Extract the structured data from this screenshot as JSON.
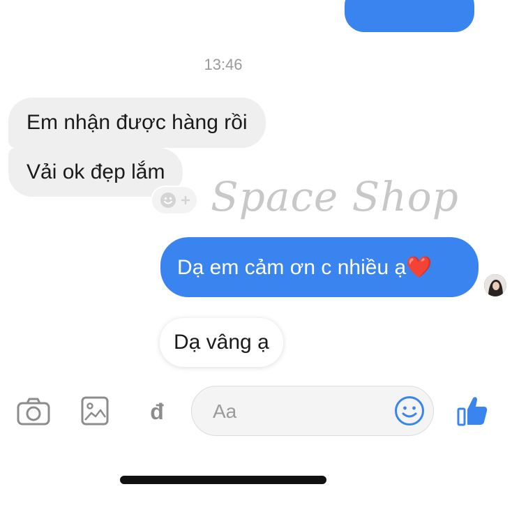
{
  "chat": {
    "timestamp": "13:46",
    "messages": [
      {
        "direction": "incoming",
        "text": "Em nhận được hàng rồi"
      },
      {
        "direction": "incoming",
        "text": "Vải ok đẹp lắm"
      },
      {
        "direction": "outgoing",
        "text": "Dạ em cảm ơn c nhiều ạ❤️"
      }
    ],
    "reply_suggestion": "Dạ vâng ạ",
    "reaction_add_icon": "emoji-add-icon"
  },
  "watermark": {
    "text": "Space Shop"
  },
  "composer": {
    "placeholder": "Aa",
    "icons": [
      "camera-icon",
      "photo-icon",
      "payment-icon",
      "emoji-icon",
      "like-icon"
    ],
    "payment_glyph": "đ"
  },
  "colors": {
    "outgoing_bubble": "#3a84f0",
    "incoming_bubble": "#efefef",
    "accent": "#3a84f0"
  }
}
